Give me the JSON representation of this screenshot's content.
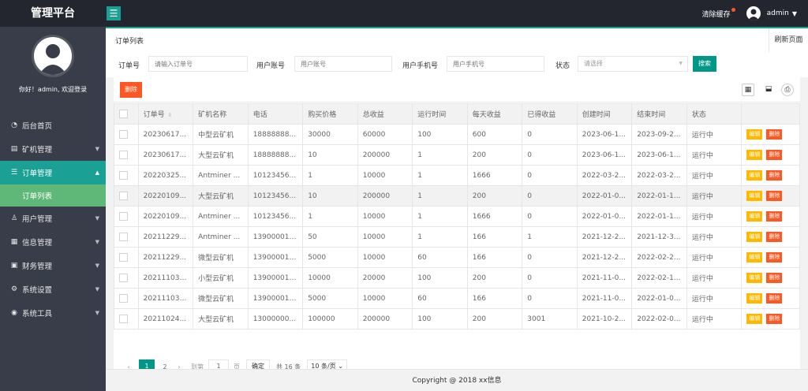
{
  "header": {
    "brand": "管理平台",
    "menu_toggle": "☰",
    "clear_cache": "清除缓存",
    "user": "admin"
  },
  "sidebar": {
    "welcome": "你好！admin, 欢迎登录",
    "items": [
      {
        "label": "后台首页",
        "icon": "dashboard-icon"
      },
      {
        "label": "矿机管理",
        "icon": "server-icon"
      },
      {
        "label": "订单管理",
        "icon": "list-icon"
      },
      {
        "label": "用户管理",
        "icon": "user-icon"
      },
      {
        "label": "信息管理",
        "icon": "file-icon"
      },
      {
        "label": "财务管理",
        "icon": "finance-icon"
      },
      {
        "label": "系统设置",
        "icon": "gear-icon"
      },
      {
        "label": "系统工具",
        "icon": "tool-icon"
      }
    ],
    "sub_item": "订单列表"
  },
  "tab": {
    "title": "订单列表",
    "refresh": "刷新页面"
  },
  "search": {
    "order_no_label": "订单号",
    "order_no_placeholder": "请输入订单号",
    "account_label": "用户账号",
    "account_placeholder": "用户账号",
    "phone_label": "用户手机号",
    "phone_placeholder": "用户手机号",
    "status_label": "状态",
    "status_placeholder": "请选择",
    "button": "搜索"
  },
  "toolbar": {
    "delete": "删除"
  },
  "table": {
    "headers": [
      "订单号",
      "矿机名称",
      "电话",
      "购买价格",
      "总收益",
      "运行时间",
      "每天收益",
      "已得收益",
      "创建时间",
      "结束时间",
      "状态"
    ],
    "edit_label": "编辑",
    "delete_label": "删除",
    "rows": [
      [
        "20230617...",
        "中型云矿机",
        "18888888...",
        "30000",
        "60000",
        "100",
        "600",
        "0",
        "2023-06-1...",
        "2023-09-2...",
        "运行中"
      ],
      [
        "20230617...",
        "大型云矿机",
        "18888888...",
        "10",
        "200000",
        "1",
        "200",
        "0",
        "2023-06-1...",
        "2023-06-1...",
        "运行中"
      ],
      [
        "20220325...",
        "Antminer ...",
        "10123456...",
        "1",
        "10000",
        "1",
        "1666",
        "0",
        "2022-03-2...",
        "2022-03-2...",
        "运行中"
      ],
      [
        "20220109...",
        "大型云矿机",
        "10123456...",
        "10",
        "200000",
        "1",
        "200",
        "0",
        "2022-01-0...",
        "2022-01-1...",
        "运行中"
      ],
      [
        "20220109...",
        "Antminer ...",
        "10123456...",
        "1",
        "10000",
        "1",
        "1666",
        "0",
        "2022-01-0...",
        "2022-01-1...",
        "运行中"
      ],
      [
        "20211229...",
        "Antminer ...",
        "139000011...",
        "50",
        "10000",
        "1",
        "166",
        "1",
        "2021-12-2...",
        "2021-12-3...",
        "运行中"
      ],
      [
        "20211229...",
        "微型云矿机",
        "139000011...",
        "5000",
        "10000",
        "60",
        "166",
        "0",
        "2021-12-2...",
        "2022-02-2...",
        "运行中"
      ],
      [
        "202111030...",
        "小型云矿机",
        "139000011...",
        "10000",
        "20000",
        "100",
        "200",
        "0",
        "2021-11-0...",
        "2022-02-1...",
        "运行中"
      ],
      [
        "202111030...",
        "微型云矿机",
        "139000011...",
        "5000",
        "10000",
        "60",
        "166",
        "0",
        "2021-11-0...",
        "2022-01-0...",
        "运行中"
      ],
      [
        "20211024...",
        "大型云矿机",
        "13000000...",
        "100000",
        "200000",
        "100",
        "200",
        "3001",
        "2021-10-2...",
        "2022-02-0...",
        "运行中"
      ]
    ]
  },
  "pager": {
    "prev": "‹",
    "current": "1",
    "page2": "2",
    "next": "›",
    "goto": "到第",
    "input": "1",
    "page_unit": "页",
    "confirm": "确定",
    "total": "共 16 条",
    "limit": "10 条/页"
  },
  "footer": "Copyright @ 2018 xx信息",
  "colors": {
    "accent": "#1aa094",
    "sidebar_bg": "#393d49",
    "header_bg": "#23262e",
    "sub_active": "#5fb878",
    "danger": "#ff5722",
    "warn": "#ffb800",
    "primary_btn": "#009688"
  }
}
